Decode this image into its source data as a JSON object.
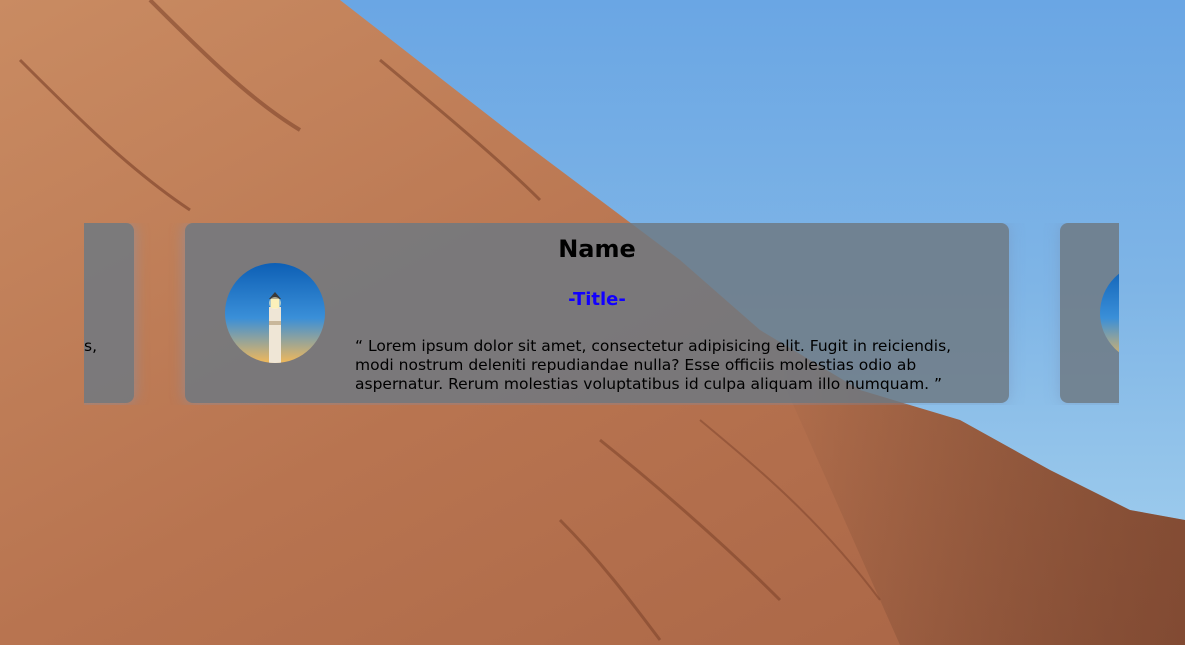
{
  "testimonial": {
    "name": "Name",
    "title": "-Title-",
    "quote": "“ Lorem ipsum dolor sit amet, consectetur adipisicing elit. Fugit in reiciendis, modi nostrum deleniti repudiandae nulla? Esse officiis molestias odio ab aspernatur. Rerum molestias voluptatibus id culpa aliquam illo numquam. ”",
    "avatar_icon": "lighthouse-photo"
  },
  "prev_card": {
    "visible_fragment": "s,"
  },
  "colors": {
    "title": "#1200ff",
    "card_bg": "#6e7882"
  }
}
